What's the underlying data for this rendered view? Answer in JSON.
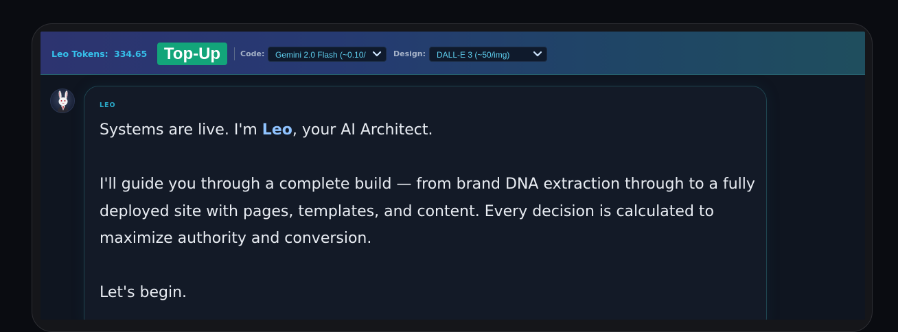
{
  "topbar": {
    "tokens_label": "Leo Tokens:",
    "tokens_value": "334.65",
    "topup_label": "Top-Up",
    "code_label": "Code:",
    "code_select_value": "Gemini 2.0 Flash (~0.10/",
    "design_label": "Design:",
    "design_select_value": "DALL-E 3 (~50/img)"
  },
  "chat": {
    "sender": "LEO",
    "intro_prefix": "Systems are live. I'm ",
    "intro_name": "Leo",
    "intro_suffix": ", your AI Architect.",
    "paragraph": "I'll guide you through a complete build — from brand DNA extraction through to a fully deployed site with pages, templates, and content. Every decision is calculated to maximize authority and conversion.",
    "closing": "Let's begin."
  },
  "icons": {
    "select_chevron": "chevron-down-icon",
    "avatar": "rabbit-avatar-icon"
  },
  "colors": {
    "accent_cyan": "#36c0ea",
    "topup_green": "#13a57a",
    "highlight": "#8fc3ff",
    "bubble_border": "#1e4550"
  }
}
